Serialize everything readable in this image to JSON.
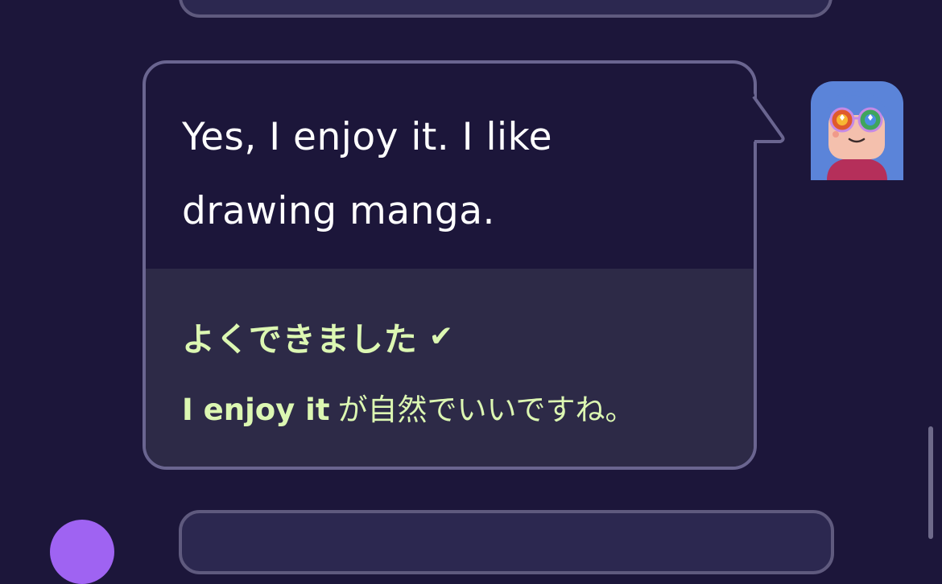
{
  "message": {
    "text": "Yes, I enjoy it. I like drawing manga."
  },
  "feedback": {
    "title": "よくできました",
    "check_icon": "check-icon",
    "highlight": "I enjoy it",
    "comment": "が自然でいいですね。"
  },
  "avatar": {
    "icon": "user-avatar-glasses"
  },
  "colors": {
    "background": "#1c163a",
    "bubble_border": "#6a6590",
    "feedback_bg": "#2d2a47",
    "feedback_text": "#dcf7b2"
  }
}
